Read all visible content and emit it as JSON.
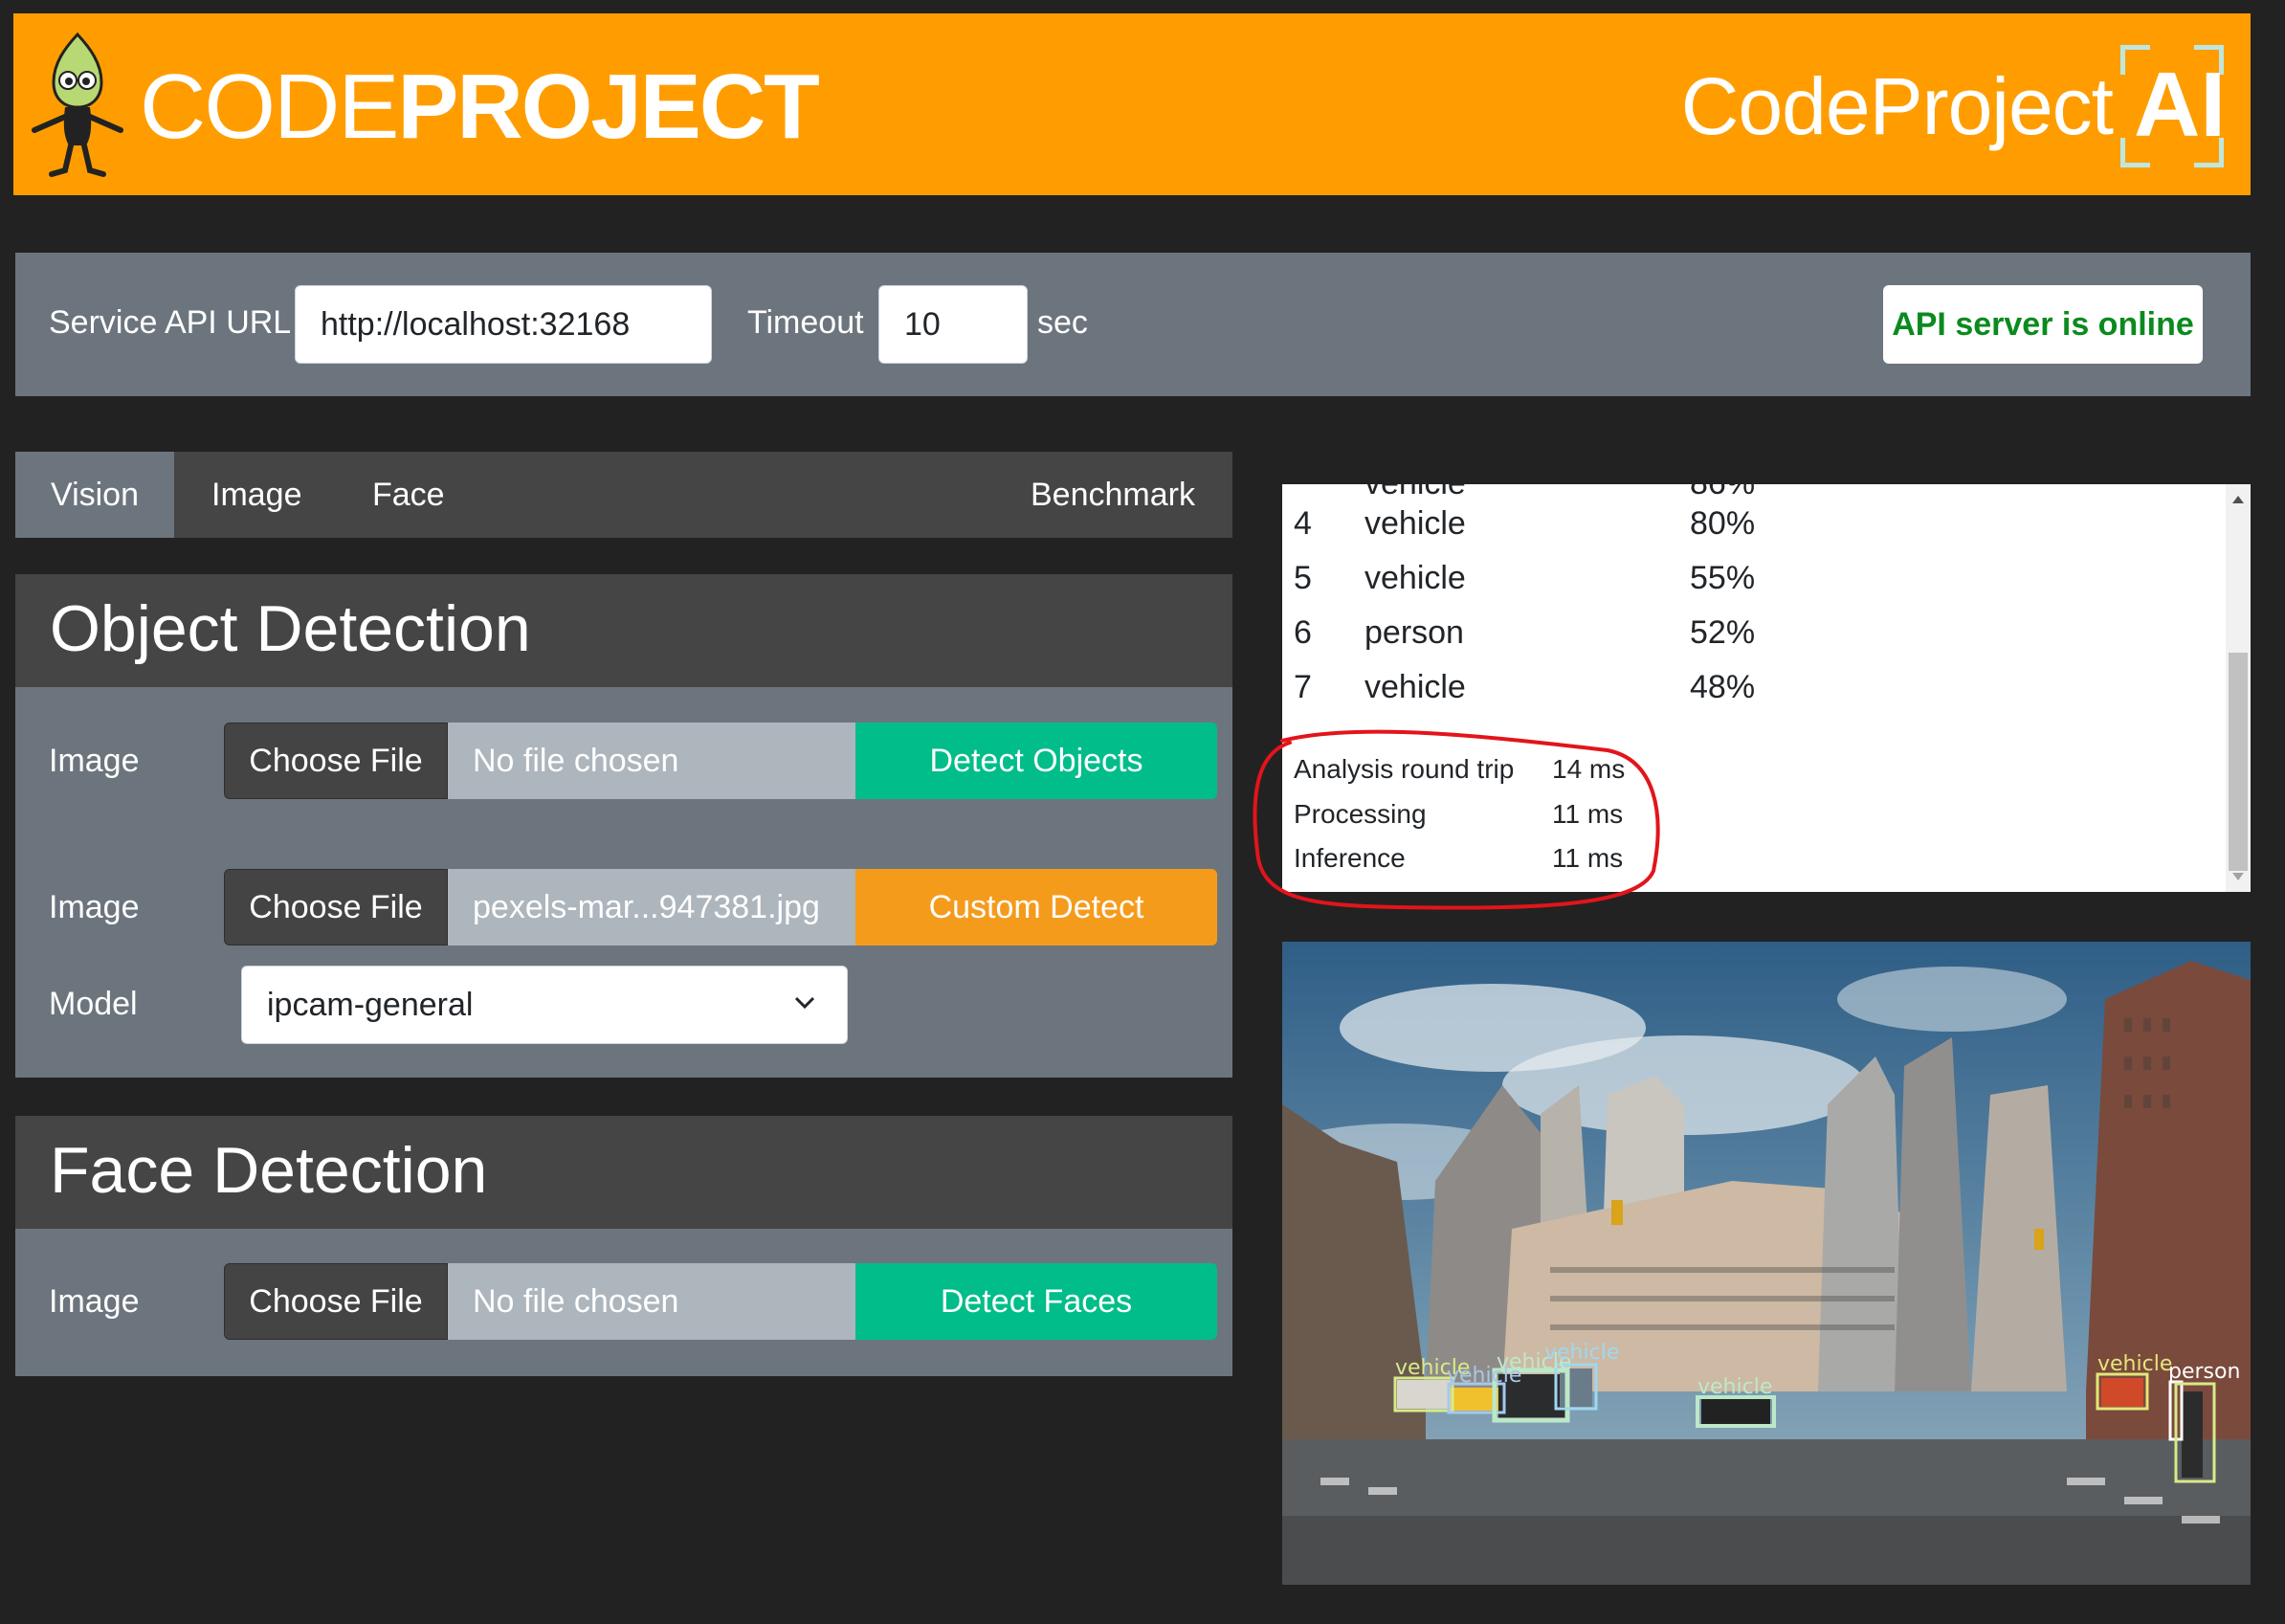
{
  "header": {
    "brand_left_thin": "CODE",
    "brand_left_bold": "PROJECT",
    "brand_right": "CodeProject",
    "brand_ai": "AI"
  },
  "service": {
    "api_url_label": "Service API URL",
    "api_url_value": "http://localhost:32168",
    "timeout_label": "Timeout",
    "timeout_value": "10",
    "timeout_unit": "sec",
    "status": "API server is online"
  },
  "tabs": [
    {
      "label": "Vision",
      "active": true
    },
    {
      "label": "Image",
      "active": false
    },
    {
      "label": "Face",
      "active": false
    },
    {
      "label": "Benchmark",
      "active": false
    }
  ],
  "object_detection": {
    "title": "Object Detection",
    "row1": {
      "label": "Image",
      "choose": "Choose File",
      "file": "No file chosen",
      "button": "Detect Objects"
    },
    "row2": {
      "label": "Image",
      "choose": "Choose File",
      "file": "pexels-mar...947381.jpg",
      "button": "Custom Detect"
    },
    "model": {
      "label": "Model",
      "selected": "ipcam-general"
    }
  },
  "face_detection": {
    "title": "Face Detection",
    "row1": {
      "label": "Image",
      "choose": "Choose File",
      "file": "No file chosen",
      "button": "Detect Faces"
    }
  },
  "results": {
    "rows": [
      {
        "num": "4",
        "label": "vehicle",
        "conf": "80%"
      },
      {
        "num": "5",
        "label": "vehicle",
        "conf": "55%"
      },
      {
        "num": "6",
        "label": "person",
        "conf": "52%"
      },
      {
        "num": "7",
        "label": "vehicle",
        "conf": "48%"
      }
    ],
    "stats": [
      {
        "label": "Analysis round trip",
        "value": "14 ms"
      },
      {
        "label": "Processing",
        "value": "11 ms"
      },
      {
        "label": "Inference",
        "value": "11 ms"
      }
    ]
  },
  "image": {
    "detections": [
      "vehicle",
      "vehicle",
      "vehicle",
      "vehicle",
      "vehicle",
      "vehicle",
      "person"
    ]
  },
  "colors": {
    "brand_orange": "#ff9d00",
    "panel_gray": "#6c757d",
    "dark_gray": "#454545",
    "green": "#00bd8a",
    "orange": "#f59b1c",
    "status_green": "#0b8a1e",
    "annotation_red": "#e3141b"
  }
}
